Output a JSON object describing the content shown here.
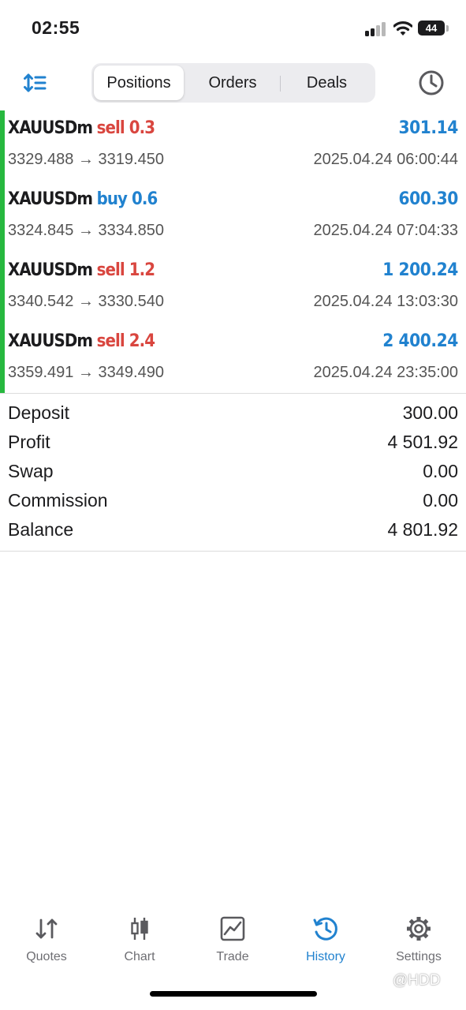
{
  "status_bar": {
    "time": "02:55",
    "battery": "44"
  },
  "toolbar": {
    "segments": [
      {
        "label": "Positions",
        "active": true
      },
      {
        "label": "Orders",
        "active": false
      },
      {
        "label": "Deals",
        "active": false
      }
    ]
  },
  "positions": [
    {
      "symbol": "XAUUSDm",
      "type": "sell 0.3",
      "side": "sell",
      "profit": "301.14",
      "prices": "3329.488 → 3319.450",
      "time": "2025.04.24 06:00:44"
    },
    {
      "symbol": "XAUUSDm",
      "type": "buy 0.6",
      "side": "buy",
      "profit": "600.30",
      "prices": "3324.845 → 3334.850",
      "time": "2025.04.24 07:04:33"
    },
    {
      "symbol": "XAUUSDm",
      "type": "sell 1.2",
      "side": "sell",
      "profit": "1 200.24",
      "prices": "3340.542 → 3330.540",
      "time": "2025.04.24 13:03:30"
    },
    {
      "symbol": "XAUUSDm",
      "type": "sell 2.4",
      "side": "sell",
      "profit": "2 400.24",
      "prices": "3359.491 → 3349.490",
      "time": "2025.04.24 23:35:00"
    }
  ],
  "summary": [
    {
      "label": "Deposit",
      "value": "300.00"
    },
    {
      "label": "Profit",
      "value": "4 501.92"
    },
    {
      "label": "Swap",
      "value": "0.00"
    },
    {
      "label": "Commission",
      "value": "0.00"
    },
    {
      "label": "Balance",
      "value": "4 801.92"
    }
  ],
  "tab_bar": {
    "tabs": [
      {
        "label": "Quotes",
        "icon": "quotes-icon",
        "active": false
      },
      {
        "label": "Chart",
        "icon": "chart-icon",
        "active": false
      },
      {
        "label": "Trade",
        "icon": "trade-icon",
        "active": false
      },
      {
        "label": "History",
        "icon": "history-icon",
        "active": true
      },
      {
        "label": "Settings",
        "icon": "settings-icon",
        "active": false
      }
    ]
  },
  "watermark": "@HDD",
  "colors": {
    "sell": "#d9463f",
    "buy": "#2182cf",
    "profit": "#2182cf",
    "accent": "#2182cf",
    "position_marker": "#27b83f",
    "inactive": "#6e6e73"
  }
}
